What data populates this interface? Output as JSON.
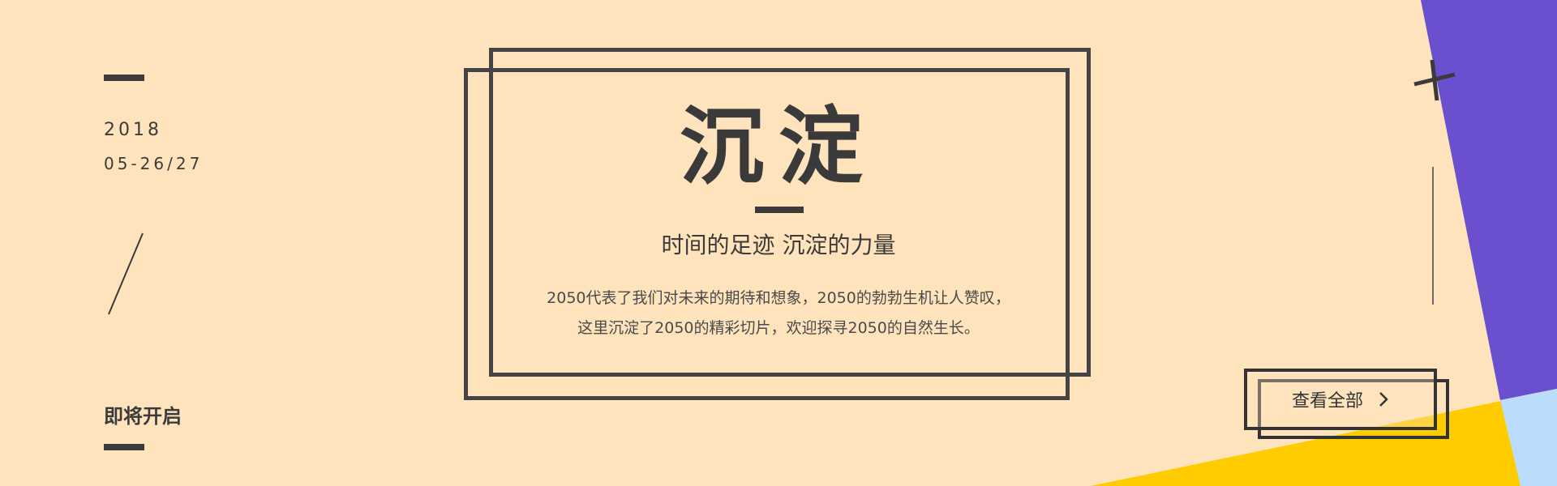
{
  "left": {
    "year": "2018",
    "dates": "05-26/27",
    "coming_soon": "即将开启"
  },
  "center": {
    "title": "沉淀",
    "subtitle": "时间的足迹  沉淀的力量",
    "desc_line1": "2050代表了我们对未来的期待和想象，2050的勃勃生机让人赞叹，",
    "desc_line2": "这里沉淀了2050的精彩切片，欢迎探寻2050的自然生长。"
  },
  "cta": {
    "label": "查看全部",
    "icon": "chevron-right-icon"
  },
  "colors": {
    "background": "#ffe3bd",
    "purple": "#6a4fcf",
    "yellow": "#ffcc00",
    "light_blue": "#bcdcfb",
    "ink": "#3b3b3b"
  }
}
